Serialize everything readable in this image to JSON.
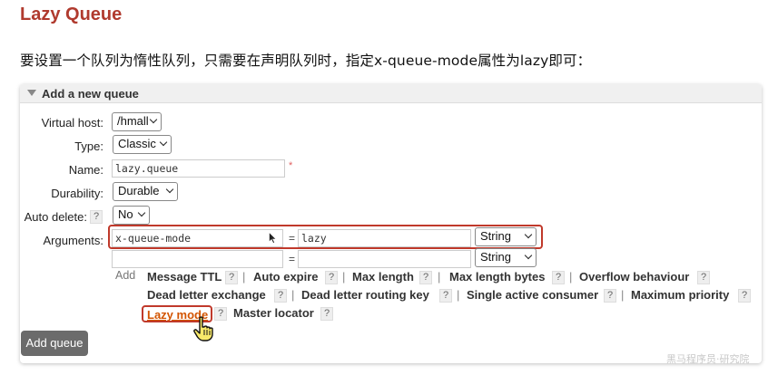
{
  "page": {
    "title": "Lazy Queue",
    "intro": "要设置一个队列为惰性队列，只需要在声明队列时，指定x-queue-mode属性为lazy即可："
  },
  "panel": {
    "title": "Add a new queue",
    "fields": {
      "virtual_host": {
        "label": "Virtual host:",
        "value": "/hmall"
      },
      "type": {
        "label": "Type:",
        "value": "Classic"
      },
      "name": {
        "label": "Name:",
        "value": "lazy.queue",
        "required_mark": "*"
      },
      "durability": {
        "label": "Durability:",
        "value": "Durable"
      },
      "auto_delete": {
        "label": "Auto delete:",
        "value": "No",
        "help": "?"
      },
      "arguments": {
        "label": "Arguments:",
        "rows": [
          {
            "key": "x-queue-mode",
            "eq": "=",
            "value": "lazy",
            "type": "String"
          },
          {
            "key": "",
            "eq": "=",
            "value": "",
            "type": "String"
          }
        ]
      }
    },
    "add_label": "Add",
    "shortcuts": {
      "message_ttl": "Message TTL",
      "auto_expire": "Auto expire",
      "max_length": "Max length",
      "max_length_bytes": "Max length bytes",
      "overflow_behaviour": "Overflow behaviour",
      "dead_letter_exchange": "Dead letter exchange",
      "dead_letter_routing_key": "Dead letter routing key",
      "single_active_consumer": "Single active consumer",
      "maximum_priority": "Maximum priority",
      "lazy_mode": "Lazy mode",
      "master_locator": "Master locator"
    },
    "help_mark": "?",
    "separator": "|",
    "add_queue_button": "Add queue"
  },
  "watermark": "黑马程序员·研究院",
  "colors": {
    "title": "#b03a2e",
    "highlight": "#c0392b",
    "lazy_link": "#d35400",
    "button_bg": "#6b6b6b"
  }
}
